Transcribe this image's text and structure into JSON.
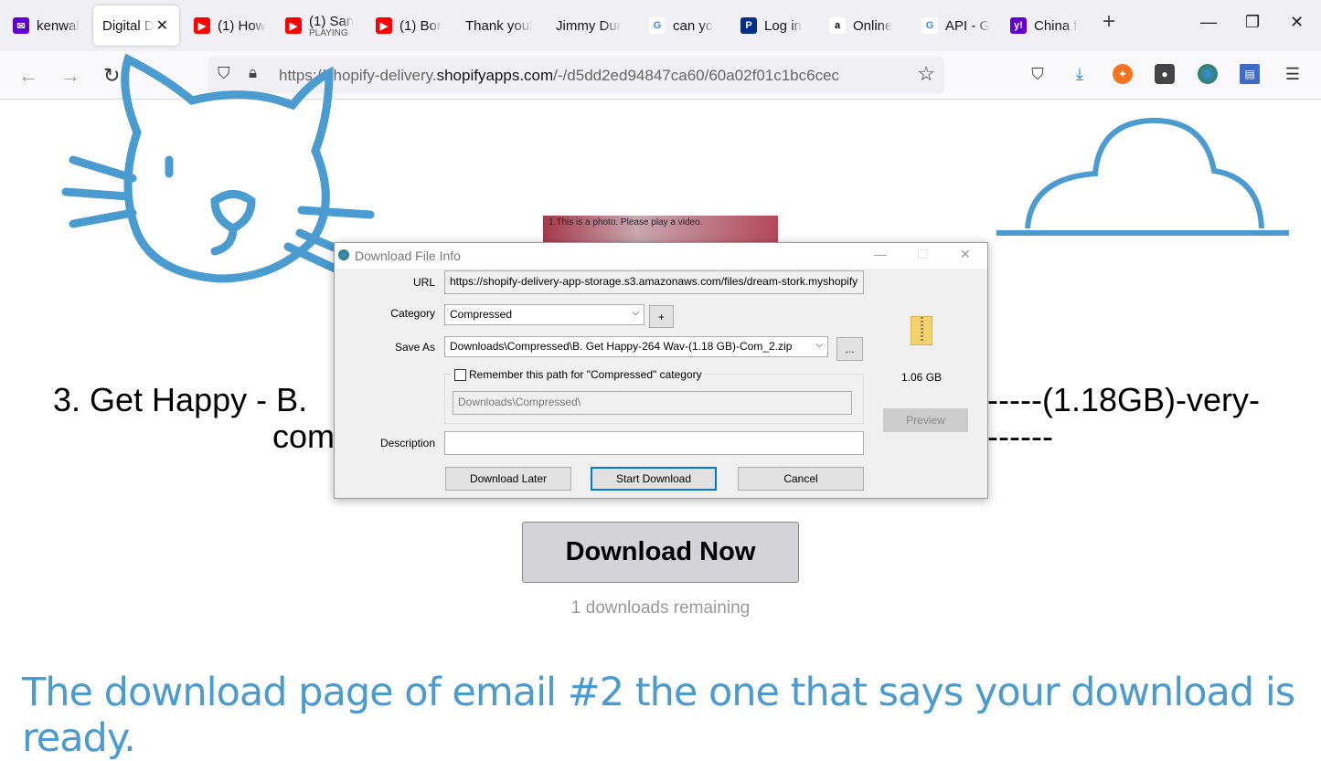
{
  "browser": {
    "tabs": [
      {
        "label": "kenwal",
        "icon": "yahoo-mail-icon",
        "color": "#5f01d1"
      },
      {
        "label": "Digital D",
        "active": true
      },
      {
        "label": "(1) How",
        "icon": "youtube-icon",
        "color": "#ff0000"
      },
      {
        "label": "(1) San",
        "sub": "PLAYING",
        "icon": "youtube-icon",
        "color": "#ff0000"
      },
      {
        "label": "(1) Bor",
        "icon": "youtube-icon",
        "color": "#ff0000"
      },
      {
        "label": "Thank you!"
      },
      {
        "label": "Jimmy Dur"
      },
      {
        "label": "can yo",
        "icon": "google-icon",
        "color": "#4285f4"
      },
      {
        "label": "Log in",
        "icon": "paypal-icon",
        "color": "#003087"
      },
      {
        "label": "Online",
        "icon": "amazon-icon",
        "color": "#000000"
      },
      {
        "label": "API - G",
        "icon": "google-icon",
        "color": "#4285f4"
      },
      {
        "label": "China f",
        "icon": "yahoo-icon",
        "color": "#6001d2"
      }
    ],
    "url_prefix": "https://shopify-delivery.",
    "url_domain": "shopifyapps.com",
    "url_path": "/-/d5dd2ed94847ca60/60a02f01c1bc6cec"
  },
  "page": {
    "heading_line1_left": "3. Get Happy - B.",
    "heading_line1_right": "-----(1.18GB)-very-",
    "heading_line2_left": "com",
    "heading_line2_right": "------",
    "photo_text": "1.This is a photo. Please play a video.",
    "download_now": "Download Now",
    "remaining": "1 downloads remaining",
    "caption": "The download page of email #2 the one that says your download is ready.",
    "accent_color": "#4a9bd0"
  },
  "dialog": {
    "title": "Download File Info",
    "url_label": "URL",
    "url_value": "https://shopify-delivery-app-storage.s3.amazonaws.com/files/dream-stork.myshopify",
    "category_label": "Category",
    "category_value": "Compressed",
    "add_label": "+",
    "saveas_label": "Save As",
    "saveas_value": "Downloads\\Compressed\\B. Get Happy-264 Wav-(1.18 GB)-Com_2.zip",
    "browse_label": "...",
    "remember_label": "Remember this path for \"Compressed\" category",
    "remember_checked": false,
    "remember_path": "Downloads\\Compressed\\",
    "description_label": "Description",
    "description_value": "",
    "size": "1.06  GB",
    "preview": "Preview",
    "download_later": "Download Later",
    "start_download": "Start Download",
    "cancel": "Cancel"
  }
}
